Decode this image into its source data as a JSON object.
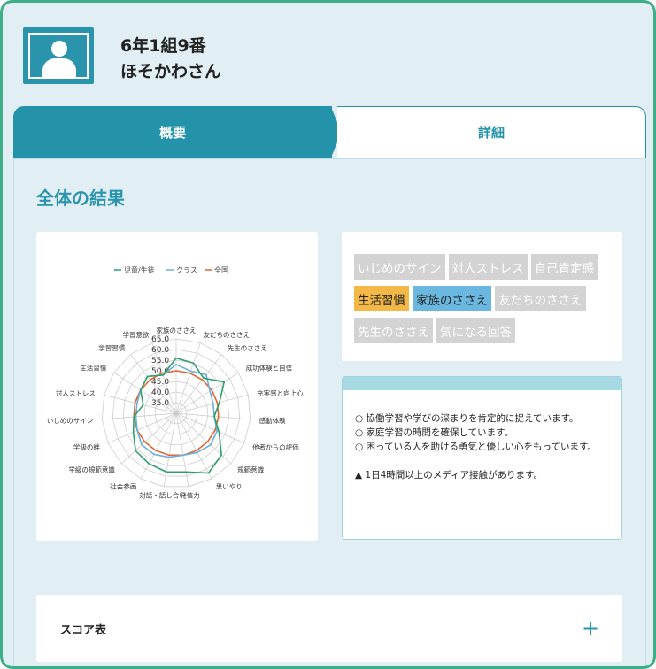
{
  "student": {
    "class_number": "6年1組9番",
    "name": "ほそかわさん"
  },
  "tabs": [
    {
      "label": "概要",
      "active": true
    },
    {
      "label": "詳細",
      "active": false
    }
  ],
  "section_title": "全体の結果",
  "legend": [
    {
      "label": "児童/生徒",
      "color": "#2e9e6b"
    },
    {
      "label": "クラス",
      "color": "#6aaedb"
    },
    {
      "label": "全国",
      "color": "#e0642e"
    }
  ],
  "chart_data": {
    "type": "radar",
    "axes": [
      "家族のささえ",
      "友だちのささえ",
      "先生のささえ",
      "成功体験と自信",
      "充実感と向上心",
      "感動体験",
      "他者からの評価",
      "規範意識",
      "思いやり",
      "発信力",
      "対話・話し合い",
      "社会参画",
      "学級の規範意識",
      "学級の絆",
      "いじめのサイン",
      "対人ストレス",
      "生活習慣",
      "学習習慣",
      "学習意欲"
    ],
    "scale_labels": [
      "65.0",
      "60.0",
      "55.0",
      "50.0",
      "45.0",
      "40.0",
      "35.0"
    ],
    "range": [
      30,
      65
    ],
    "series": [
      {
        "name": "児童/生徒",
        "color": "#2e9e6b",
        "values": [
          56,
          55,
          51,
          57,
          51,
          48,
          52,
          59,
          62,
          58,
          58,
          57,
          56,
          52,
          50,
          46,
          50,
          52,
          49
        ]
      },
      {
        "name": "クラス",
        "color": "#6aaedb",
        "values": [
          53,
          51,
          53,
          49,
          48,
          48,
          51,
          52,
          51,
          50,
          51,
          52,
          52,
          50,
          49,
          49,
          50,
          52,
          49
        ]
      },
      {
        "name": "全国",
        "color": "#e0642e",
        "values": [
          50,
          50,
          50,
          50,
          50,
          50,
          50,
          50,
          50,
          50,
          50,
          50,
          50,
          50,
          50,
          50,
          50,
          50,
          50
        ]
      }
    ]
  },
  "tags": [
    [
      {
        "label": "いじめのサイン",
        "style": "gray"
      },
      {
        "label": "対人ストレス",
        "style": "gray"
      },
      {
        "label": "自己肯定感",
        "style": "gray"
      }
    ],
    [
      {
        "label": "生活習慣",
        "style": "orange"
      },
      {
        "label": "家族のささえ",
        "style": "blue"
      },
      {
        "label": "友だちのささえ",
        "style": "gray"
      }
    ],
    [
      {
        "label": "先生のささえ",
        "style": "gray"
      },
      {
        "label": "気になる回答",
        "style": "gray"
      }
    ]
  ],
  "comments": [
    "○ 協働学習や学びの深まりを肯定的に捉えています。",
    "○ 家庭学習の時間を確保しています。",
    "○ 困っている人を助ける勇気と優しい心をもっています。"
  ],
  "alert": "▲ 1日4時間以上のメディア接触があります。",
  "score_table": {
    "label": "スコア表",
    "expand_icon": "+"
  }
}
